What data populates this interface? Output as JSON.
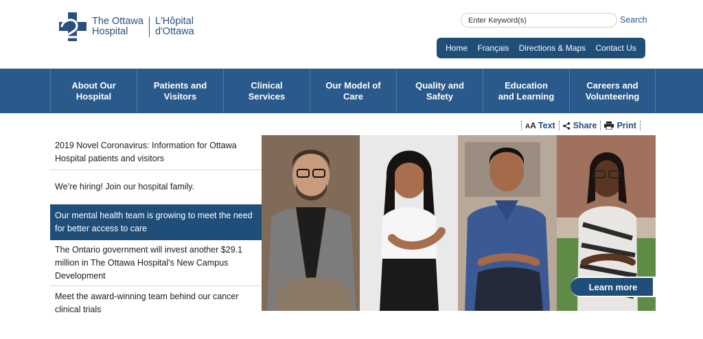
{
  "logo": {
    "name_en_line1": "The Ottawa",
    "name_en_line2": "Hospital",
    "name_fr_line1": "L'Hôpital",
    "name_fr_line2": "d'Ottawa",
    "brand_color": "#2a4f7a"
  },
  "search": {
    "placeholder": "Enter Keyword(s)",
    "button_label": "Search"
  },
  "utility_nav": [
    "Home",
    "Français",
    "Directions & Maps",
    "Contact Us"
  ],
  "main_nav": [
    {
      "line1": "About Our",
      "line2": "Hospital"
    },
    {
      "line1": "Patients and",
      "line2": "Visitors"
    },
    {
      "line1": "Clinical",
      "line2": "Services"
    },
    {
      "line1": "Our Model of",
      "line2": "Care"
    },
    {
      "line1": "Quality and",
      "line2": "Safety"
    },
    {
      "line1": "Education",
      "line2": "and Learning"
    },
    {
      "line1": "Careers and",
      "line2": "Volunteering"
    }
  ],
  "tools": {
    "text_label": "Text",
    "share_label": "Share",
    "print_label": "Print"
  },
  "news": [
    {
      "text": "2019 Novel Coronavirus: Information for Ottawa Hospital patients and visitors",
      "active": false
    },
    {
      "text": "We’re hiring! Join our hospital family.",
      "active": false
    },
    {
      "text": "Our mental health team is growing to meet the need for better access to care",
      "active": true
    },
    {
      "text": "The Ontario government will invest another $29.1 million in The Ottawa Hospital’s New Campus Development",
      "active": false
    },
    {
      "text": "Meet the award-winning team behind our cancer clinical trials",
      "active": false
    }
  ],
  "hero": {
    "cta_label": "Learn more"
  },
  "colors": {
    "nav_blue": "#2a5a8c",
    "dark_blue": "#1f4e79"
  }
}
